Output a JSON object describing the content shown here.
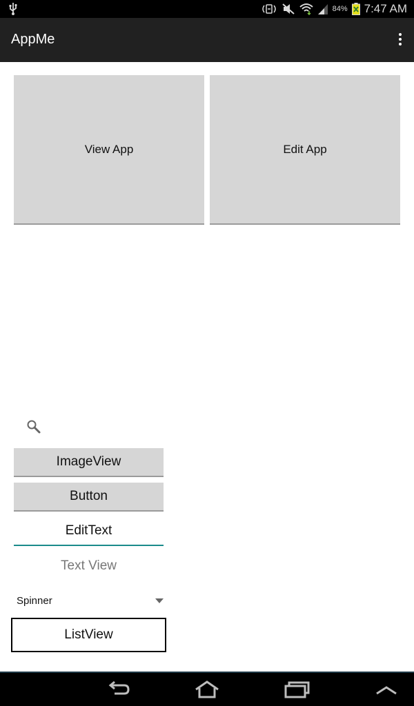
{
  "status_bar": {
    "battery_percent": "84%",
    "time": "7:47 AM",
    "icons": [
      "usb-icon",
      "nfc-icon",
      "mute-icon",
      "wifi-icon",
      "signal-icon",
      "battery-icon"
    ]
  },
  "action_bar": {
    "title": "AppMe",
    "overflow_icon": "overflow-menu-icon"
  },
  "main": {
    "view_app_label": "View App",
    "edit_app_label": "Edit App"
  },
  "widgets": {
    "search_icon": "search-icon",
    "imageview_label": "ImageView",
    "button_label": "Button",
    "edittext_value": "EditText",
    "textview_text": "Text View",
    "spinner_selected": "Spinner",
    "listview_label": "ListView"
  },
  "nav_bar": {
    "icons": [
      "back-icon",
      "home-icon",
      "recents-icon",
      "up-icon"
    ]
  },
  "colors": {
    "action_bar_bg": "#212121",
    "button_bg": "#d6d6d6",
    "edittext_underline": "#1a8a8a"
  }
}
